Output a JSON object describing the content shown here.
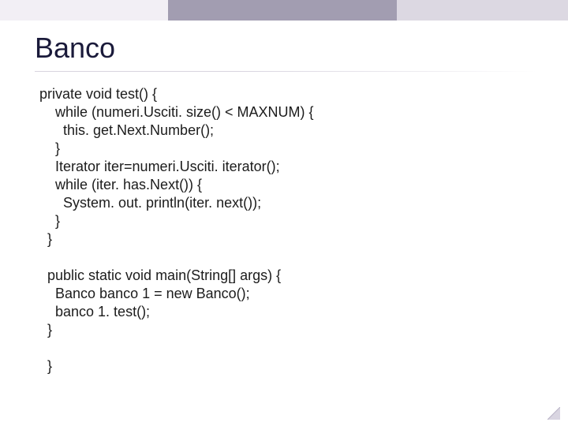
{
  "slide": {
    "title": "Banco",
    "code_lines": [
      "private void test() {",
      "    while (numeri.Usciti. size() < MAXNUM) {",
      "      this. get.Next.Number();",
      "    }",
      "    Iterator iter=numeri.Usciti. iterator();",
      "    while (iter. has.Next()) {",
      "      System. out. println(iter. next());",
      "    }",
      "  }",
      "",
      "  public static void main(String[] args) {",
      "    Banco banco 1 = new Banco();",
      "    banco 1. test();",
      "  }",
      "",
      "  }"
    ]
  },
  "colors": {
    "top_light": "#f2eff5",
    "top_dark": "#a29db1",
    "top_mid": "#dcd8e2"
  }
}
